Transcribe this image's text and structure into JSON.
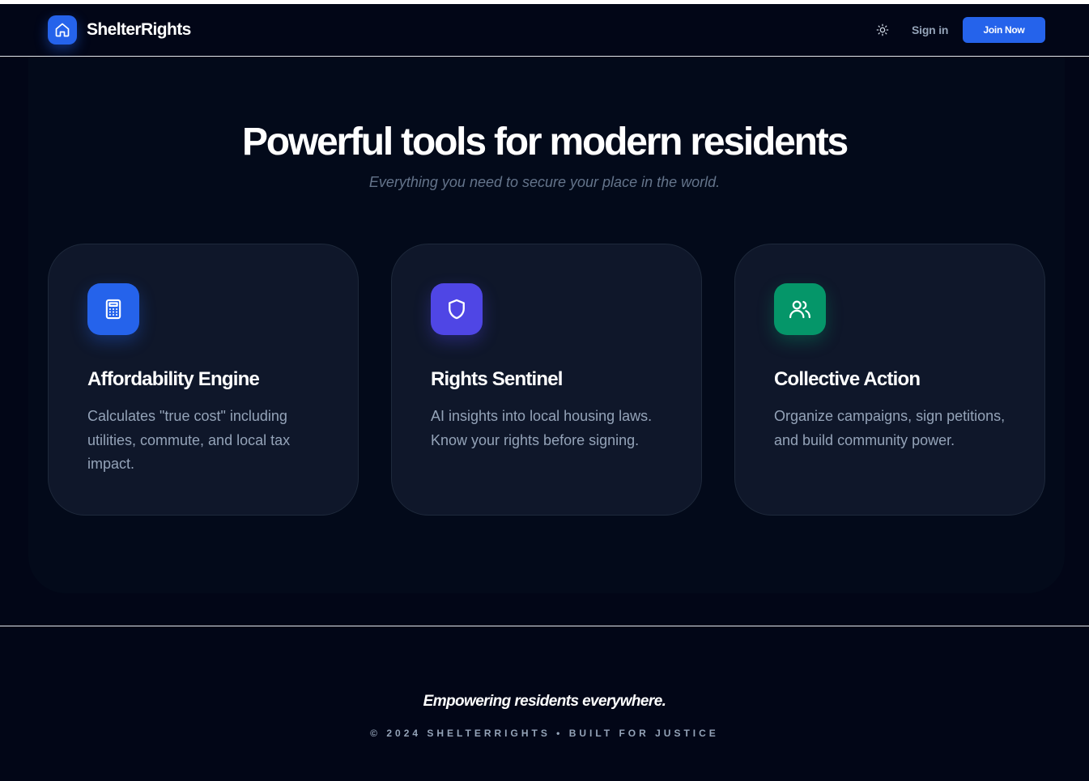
{
  "header": {
    "brand": "ShelterRights",
    "sign_in": "Sign in",
    "join_now": "Join Now"
  },
  "hero": {
    "title": "Powerful tools for modern residents",
    "subtitle": "Everything you need to secure your place in the world."
  },
  "features": [
    {
      "icon": "calculator-icon",
      "color": "#2563eb",
      "title": "Affordability Engine",
      "description": "Calculates \"true cost\" including utilities, commute, and local tax impact."
    },
    {
      "icon": "shield-icon",
      "color": "#4f46e5",
      "title": "Rights Sentinel",
      "description": "AI insights into local housing laws. Know your rights before signing."
    },
    {
      "icon": "users-icon",
      "color": "#059669",
      "title": "Collective Action",
      "description": "Organize campaigns, sign petitions, and build community power."
    }
  ],
  "footer": {
    "tagline": "Empowering residents everywhere.",
    "copyright": "© 2024 SHELTERRIGHTS • BUILT FOR JUSTICE"
  },
  "colors": {
    "background": "#020617",
    "card": "#0f172a",
    "accent": "#2563eb"
  }
}
